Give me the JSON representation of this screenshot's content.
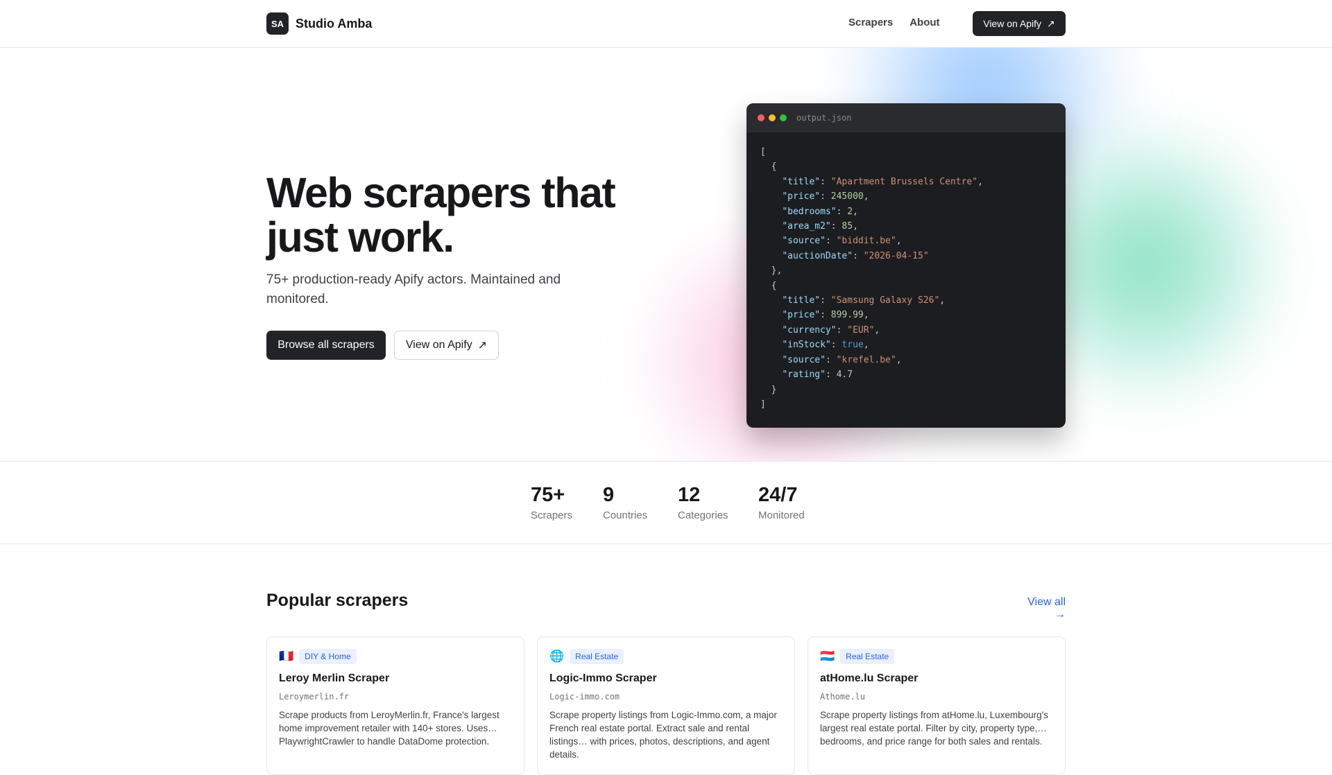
{
  "nav": {
    "logo_initials": "SA",
    "brand": "Studio Amba",
    "links": [
      "Scrapers",
      "About"
    ],
    "cta": "View on Apify",
    "cta_icon": "arrow-up-right-icon"
  },
  "hero": {
    "title": "Web scrapers that just work.",
    "subtitle": "75+ production-ready Apify actors. Maintained and monitored.",
    "primary_button": "Browse all scrapers",
    "secondary_button": "View on Apify"
  },
  "code_window": {
    "filename": "output.json",
    "items": [
      {
        "title": "Apartment Brussels Centre",
        "price": "245000",
        "bedrooms": "2",
        "area_m2": "85",
        "source": "biddit.be",
        "auctionDate": "2026-04-15"
      },
      {
        "title": "Samsung Galaxy S26",
        "price": "899.99",
        "currency": "EUR",
        "inStock": "true",
        "source": "krefel.be",
        "rating": "4.7"
      }
    ]
  },
  "stats": [
    {
      "value": "75+",
      "label": "Scrapers"
    },
    {
      "value": "9",
      "label": "Countries"
    },
    {
      "value": "12",
      "label": "Categories"
    },
    {
      "value": "24/7",
      "label": "Monitored"
    }
  ],
  "popular": {
    "title": "Popular scrapers",
    "view_all": "View all →",
    "cards": [
      {
        "flag": "🇫🇷",
        "tag": "DIY & Home",
        "title": "Leroy Merlin Scraper",
        "domain": "Leroymerlin.fr",
        "desc": "Scrape products from LeroyMerlin.fr, France's largest home improvement retailer with 140+ stores. Uses… PlaywrightCrawler to handle DataDome protection."
      },
      {
        "flag": "🌐",
        "tag": "Real Estate",
        "title": "Logic-Immo Scraper",
        "domain": "Logic-immo.com",
        "desc": "Scrape property listings from Logic-Immo.com, a major French real estate portal. Extract sale and rental listings… with prices, photos, descriptions, and agent details."
      },
      {
        "flag": "🇱🇺",
        "tag": "Real Estate",
        "title": "atHome.lu Scraper",
        "domain": "Athome.lu",
        "desc": "Scrape property listings from atHome.lu, Luxembourg's largest real estate portal. Filter by city, property type,… bedrooms, and price range for both sales and rentals."
      }
    ]
  }
}
